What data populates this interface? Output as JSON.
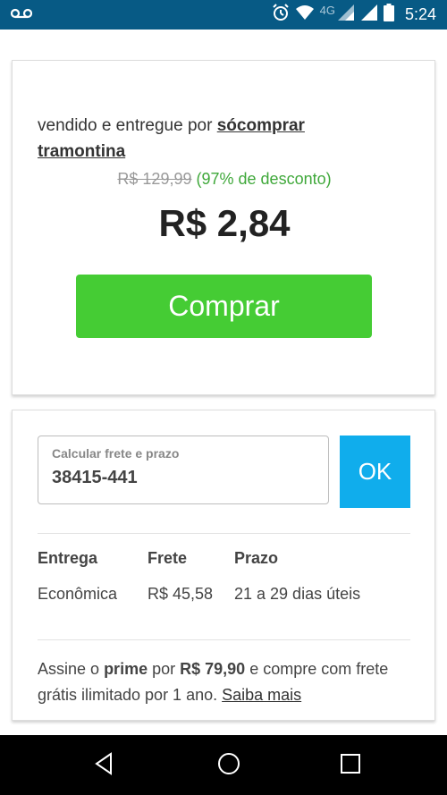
{
  "status_bar": {
    "time": "5:24",
    "network": "4G",
    "icons": [
      "voicemail-icon",
      "alarm-icon",
      "wifi-icon",
      "signal-icon",
      "battery-icon"
    ]
  },
  "offer": {
    "seller_prefix": "vendido e entregue por",
    "seller_name_1": "sócomprar",
    "seller_name_2": "tramontina",
    "old_price": "R$ 129,99",
    "discount": "(97% de desconto)",
    "price": "R$ 2,84",
    "buy_label": "Comprar"
  },
  "shipping": {
    "zip_label": "Calcular frete e prazo",
    "zip_value": "38415-441",
    "ok_label": "OK",
    "headers": [
      "Entrega",
      "Frete",
      "Prazo"
    ],
    "rows": [
      [
        "Econômica",
        "R$ 45,58",
        "21 a 29 dias úteis"
      ]
    ]
  },
  "promo": {
    "text_1": "Assine o",
    "prime": "prime",
    "text_2": "por",
    "prime_price": "R$ 79,90",
    "text_3": "e compre com frete grátis ilimitado por 1 ano.",
    "link": "Saiba mais"
  },
  "colors": {
    "status_bar": "#075a85",
    "buy_button": "#45cc34",
    "ok_button": "#10adec",
    "discount": "#3fa83a"
  }
}
